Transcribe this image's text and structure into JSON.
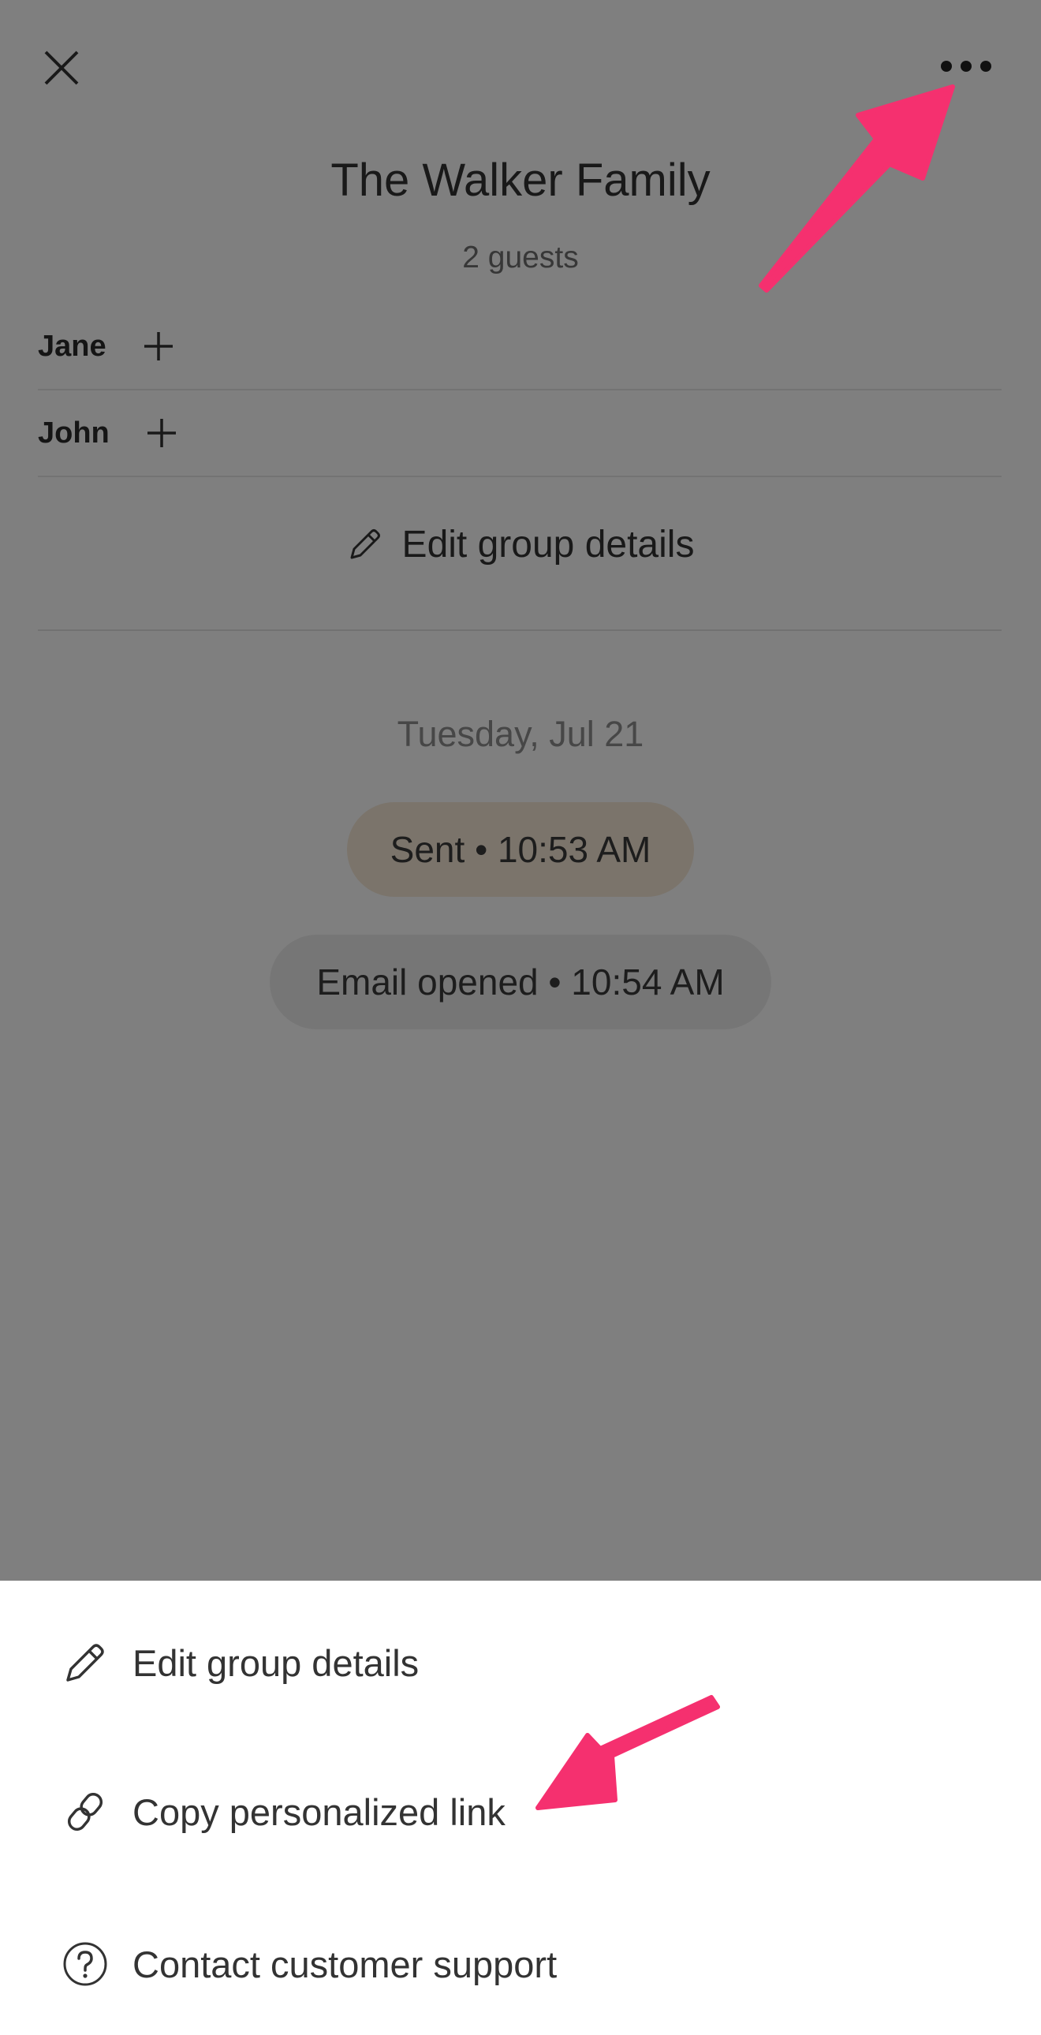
{
  "header": {
    "title": "The Walker Family",
    "subtitle": "2 guests"
  },
  "guests": [
    {
      "name": "Jane"
    },
    {
      "name": "John"
    }
  ],
  "edit_group_link": "Edit group details",
  "timeline": {
    "date": "Tuesday, Jul 21",
    "events": [
      {
        "label": "Sent • 10:53 AM"
      },
      {
        "label": "Email opened • 10:54 AM"
      }
    ]
  },
  "action_sheet": {
    "items": [
      {
        "label": "Edit group details",
        "icon": "pencil-icon"
      },
      {
        "label": "Copy personalized link",
        "icon": "link-icon"
      },
      {
        "label": "Contact customer support",
        "icon": "question-circle-icon"
      }
    ]
  },
  "colors": {
    "annotation_arrow": "#f5306f",
    "sent_pill": "#f6e8d6",
    "opened_pill": "#ececec"
  }
}
